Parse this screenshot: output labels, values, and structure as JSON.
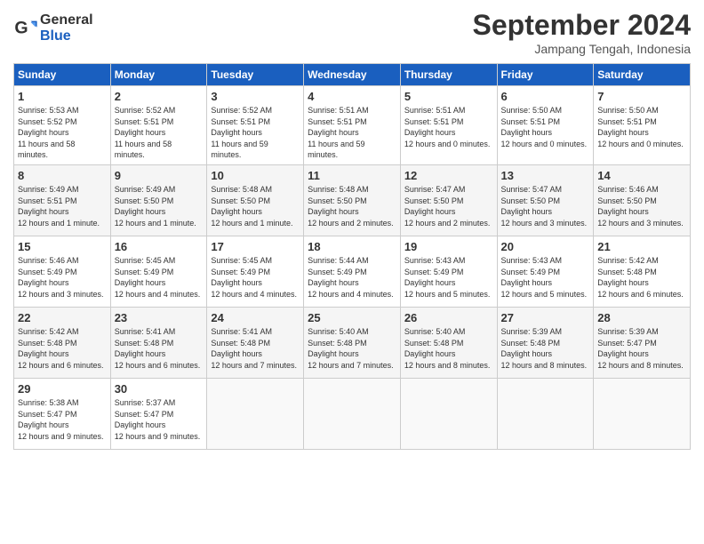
{
  "header": {
    "logo_line1": "General",
    "logo_line2": "Blue",
    "month": "September 2024",
    "location": "Jampang Tengah, Indonesia"
  },
  "days_of_week": [
    "Sunday",
    "Monday",
    "Tuesday",
    "Wednesday",
    "Thursday",
    "Friday",
    "Saturday"
  ],
  "weeks": [
    [
      {
        "day": "1",
        "sunrise": "5:53 AM",
        "sunset": "5:52 PM",
        "daylight": "11 hours and 58 minutes."
      },
      {
        "day": "2",
        "sunrise": "5:52 AM",
        "sunset": "5:51 PM",
        "daylight": "11 hours and 58 minutes."
      },
      {
        "day": "3",
        "sunrise": "5:52 AM",
        "sunset": "5:51 PM",
        "daylight": "11 hours and 59 minutes."
      },
      {
        "day": "4",
        "sunrise": "5:51 AM",
        "sunset": "5:51 PM",
        "daylight": "11 hours and 59 minutes."
      },
      {
        "day": "5",
        "sunrise": "5:51 AM",
        "sunset": "5:51 PM",
        "daylight": "12 hours and 0 minutes."
      },
      {
        "day": "6",
        "sunrise": "5:50 AM",
        "sunset": "5:51 PM",
        "daylight": "12 hours and 0 minutes."
      },
      {
        "day": "7",
        "sunrise": "5:50 AM",
        "sunset": "5:51 PM",
        "daylight": "12 hours and 0 minutes."
      }
    ],
    [
      {
        "day": "8",
        "sunrise": "5:49 AM",
        "sunset": "5:51 PM",
        "daylight": "12 hours and 1 minute."
      },
      {
        "day": "9",
        "sunrise": "5:49 AM",
        "sunset": "5:50 PM",
        "daylight": "12 hours and 1 minute."
      },
      {
        "day": "10",
        "sunrise": "5:48 AM",
        "sunset": "5:50 PM",
        "daylight": "12 hours and 1 minute."
      },
      {
        "day": "11",
        "sunrise": "5:48 AM",
        "sunset": "5:50 PM",
        "daylight": "12 hours and 2 minutes."
      },
      {
        "day": "12",
        "sunrise": "5:47 AM",
        "sunset": "5:50 PM",
        "daylight": "12 hours and 2 minutes."
      },
      {
        "day": "13",
        "sunrise": "5:47 AM",
        "sunset": "5:50 PM",
        "daylight": "12 hours and 3 minutes."
      },
      {
        "day": "14",
        "sunrise": "5:46 AM",
        "sunset": "5:50 PM",
        "daylight": "12 hours and 3 minutes."
      }
    ],
    [
      {
        "day": "15",
        "sunrise": "5:46 AM",
        "sunset": "5:49 PM",
        "daylight": "12 hours and 3 minutes."
      },
      {
        "day": "16",
        "sunrise": "5:45 AM",
        "sunset": "5:49 PM",
        "daylight": "12 hours and 4 minutes."
      },
      {
        "day": "17",
        "sunrise": "5:45 AM",
        "sunset": "5:49 PM",
        "daylight": "12 hours and 4 minutes."
      },
      {
        "day": "18",
        "sunrise": "5:44 AM",
        "sunset": "5:49 PM",
        "daylight": "12 hours and 4 minutes."
      },
      {
        "day": "19",
        "sunrise": "5:43 AM",
        "sunset": "5:49 PM",
        "daylight": "12 hours and 5 minutes."
      },
      {
        "day": "20",
        "sunrise": "5:43 AM",
        "sunset": "5:49 PM",
        "daylight": "12 hours and 5 minutes."
      },
      {
        "day": "21",
        "sunrise": "5:42 AM",
        "sunset": "5:48 PM",
        "daylight": "12 hours and 6 minutes."
      }
    ],
    [
      {
        "day": "22",
        "sunrise": "5:42 AM",
        "sunset": "5:48 PM",
        "daylight": "12 hours and 6 minutes."
      },
      {
        "day": "23",
        "sunrise": "5:41 AM",
        "sunset": "5:48 PM",
        "daylight": "12 hours and 6 minutes."
      },
      {
        "day": "24",
        "sunrise": "5:41 AM",
        "sunset": "5:48 PM",
        "daylight": "12 hours and 7 minutes."
      },
      {
        "day": "25",
        "sunrise": "5:40 AM",
        "sunset": "5:48 PM",
        "daylight": "12 hours and 7 minutes."
      },
      {
        "day": "26",
        "sunrise": "5:40 AM",
        "sunset": "5:48 PM",
        "daylight": "12 hours and 8 minutes."
      },
      {
        "day": "27",
        "sunrise": "5:39 AM",
        "sunset": "5:48 PM",
        "daylight": "12 hours and 8 minutes."
      },
      {
        "day": "28",
        "sunrise": "5:39 AM",
        "sunset": "5:47 PM",
        "daylight": "12 hours and 8 minutes."
      }
    ],
    [
      {
        "day": "29",
        "sunrise": "5:38 AM",
        "sunset": "5:47 PM",
        "daylight": "12 hours and 9 minutes."
      },
      {
        "day": "30",
        "sunrise": "5:37 AM",
        "sunset": "5:47 PM",
        "daylight": "12 hours and 9 minutes."
      },
      null,
      null,
      null,
      null,
      null
    ]
  ]
}
